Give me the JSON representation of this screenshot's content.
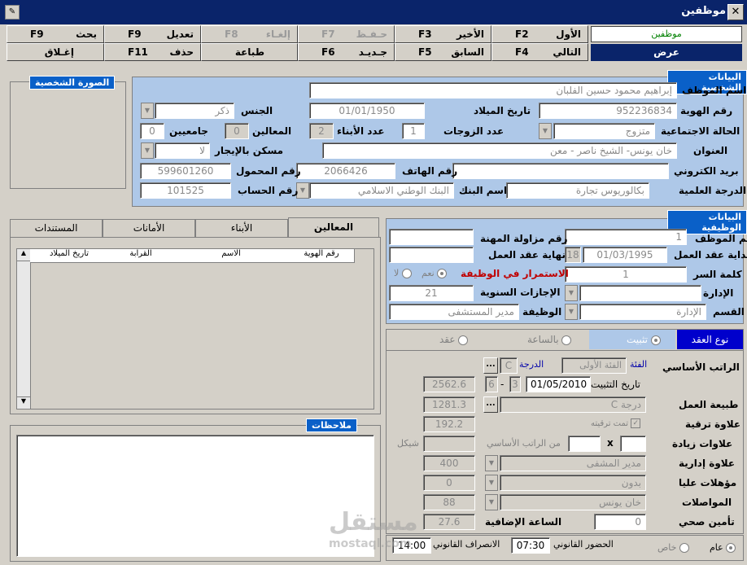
{
  "window": {
    "title": "موظفين",
    "close": "✕",
    "app_icon": "app-icon"
  },
  "toolbar": {
    "row1": [
      {
        "label": "الأول",
        "key": "F2"
      },
      {
        "label": "الأخير",
        "key": "F3"
      },
      {
        "label": "حـفـظ",
        "key": "F7",
        "disabled": true
      },
      {
        "label": "إلغـاء",
        "key": "F8",
        "disabled": true
      },
      {
        "label": "تعديل",
        "key": "F9"
      },
      {
        "label": "بحث",
        "key": "F9"
      }
    ],
    "row2": [
      {
        "label": "التالي",
        "key": "F4"
      },
      {
        "label": "السابق",
        "key": "F5"
      },
      {
        "label": "جـديـد",
        "key": "F6"
      },
      {
        "label": "طباعة",
        "key": ""
      },
      {
        "label": "حذف",
        "key": "F11"
      },
      {
        "label": "إغـلاق",
        "key": ""
      }
    ],
    "form_name": "موظفين",
    "mode": "عرض"
  },
  "photo": {
    "title": "الصورة الشخصية"
  },
  "personal": {
    "title": "البيانات الشخصية",
    "name_label": "اسم الموظف",
    "name": "إبراهيم محمود حسين الفلبان",
    "id_label": "رقم الهوية",
    "id": "952236834",
    "dob_label": "تاريخ الميلاد",
    "dob": "01/01/1950",
    "gender_label": "الجنس",
    "gender": "ذكر",
    "marital_label": "الحالة الاجتماعية",
    "marital": "متزوج",
    "wives_label": "عدد الزوجات",
    "wives": "1",
    "children_label": "عدد الأبناء",
    "children": "2",
    "dependents_label": "المعالين",
    "dependents": "0",
    "univ_label": "جامعيين",
    "univ": "0",
    "address_label": "العنوان",
    "address": "خان يونس- الشيخ ناصر - معن",
    "rent_label": "مسكن بالإيجار",
    "rent": "لا",
    "email_label": "بريد الكتروني",
    "email": "",
    "phone_label": "رقم الهاتف",
    "phone": "2066426",
    "mobile_label": "رقم المحمول",
    "mobile": "599601260",
    "degree_label": "الدرجة العلمية",
    "degree": "بكالوريوس تجارة",
    "bank_label": "اسم البنك",
    "bank": "البنك الوطني الاسلامي",
    "account_label": "رقم الحساب",
    "account": "101525"
  },
  "tabs": {
    "items": [
      "المعالين",
      "الأبناء",
      "الأمانات",
      "المستندات"
    ],
    "active": 0,
    "columns": [
      "رقم الهوية",
      "الاسم",
      "القرابة",
      "تاريخ الميلاد"
    ]
  },
  "notes": {
    "title": "ملاحظات"
  },
  "job": {
    "title": "البيانات الوظيفية",
    "emp_no_label": "رقم الموظف",
    "emp_no": "1",
    "license_label": "رقم مزاولة المهنة",
    "license": "",
    "contract_start_label": "بداية عقد العمل",
    "contract_start": "01/03/1995",
    "contract_day": "18",
    "contract_end_label": "نهاية عقد العمل",
    "contract_end": "",
    "password_label": "كلمة السر",
    "password": "1",
    "continue_label": "الاستمرار في الوظيفة",
    "yes": "نعم",
    "no": "لا",
    "admin_label": "الإدارة",
    "admin": "",
    "leave_label": "الإجازات السنوية",
    "leave": "21",
    "dept_label": "القسم",
    "dept": "الإدارة",
    "position_label": "الوظيفة",
    "position": "مدير المستشفى"
  },
  "contract": {
    "type_label": "نوع العقد",
    "opt_fixed": "تثبيت",
    "opt_hourly": "بالساعة",
    "opt_contract": "عقد",
    "basic_label": "الراتب الأساسي",
    "category_label": "الفئة",
    "category": "الفئة الأولى",
    "grade_label": "الدرجة",
    "grade": "C",
    "fix_date_label": "تاريخ التثبيت",
    "fix_date": "01/05/2010",
    "fix_a": "3",
    "fix_b": "6",
    "basic": "2562.6",
    "work_nature_label": "طبيعة العمل",
    "work_nature": "1281.3",
    "grade_combo": "درجة C",
    "promotion_label": "علاوة ترقية",
    "promotion": "192.2",
    "promo_check": "تمت ترقيته",
    "increase_label": "علاوات زيادة",
    "increase_of": "من الراتب الأساسي",
    "x": "x",
    "shekel": "شيكل",
    "admin_allow_label": "علاوة إدارية",
    "admin_allow": "400",
    "admin_allow_combo": "مدير المشفى",
    "qual_label": "مؤهلات عليا",
    "qual": "0",
    "qual_combo": "بدون",
    "transport_label": "المواصلات",
    "transport": "88",
    "transport_combo": "خان يونس",
    "insurance_label": "تأمين صحي",
    "insurance": "0",
    "overtime_label": "الساعة الإضافية",
    "overtime": "27.6"
  },
  "attendance": {
    "in_label": "الحضور القانوني",
    "in": "07:30",
    "out_label": "الانصراف القانوني",
    "out": "14:00",
    "public": "عام",
    "private": "خاص"
  },
  "watermark": {
    "line1": "مستقل",
    "line2": "mostaql.com"
  }
}
